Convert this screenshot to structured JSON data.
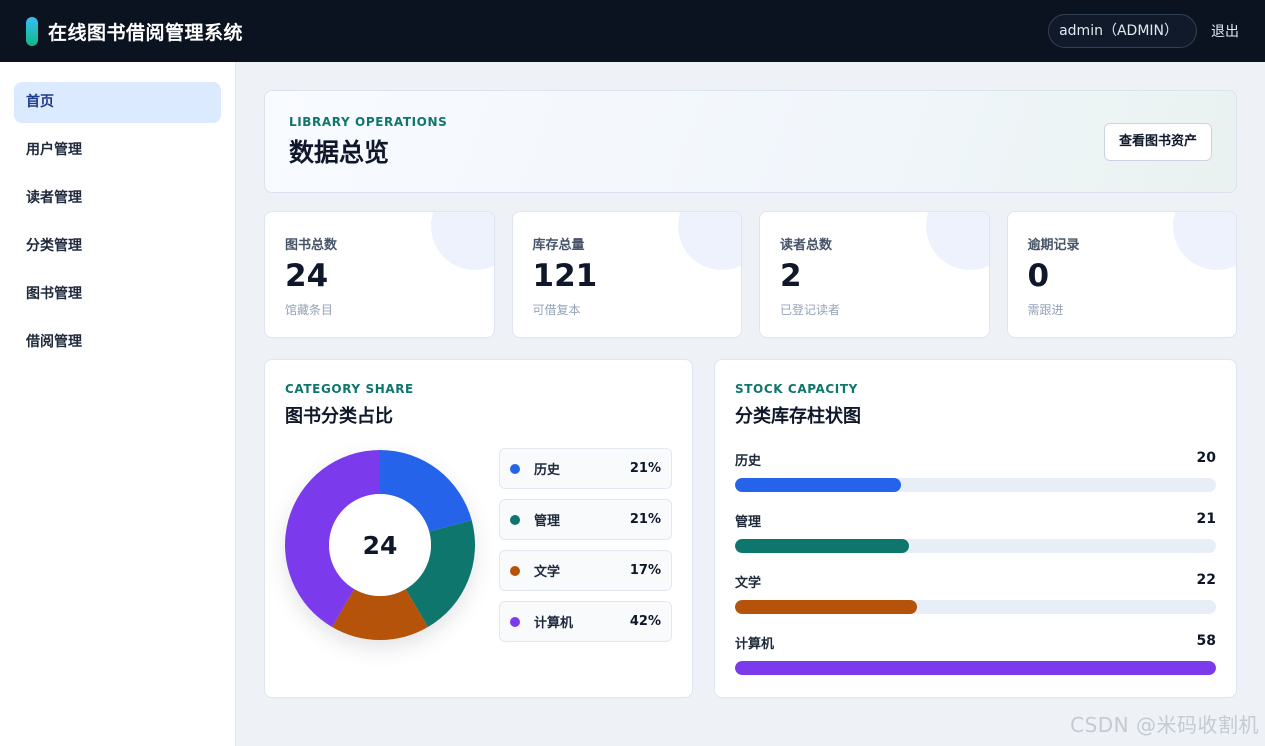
{
  "topbar": {
    "title": "在线图书借阅管理系统",
    "user": "admin（ADMIN）",
    "logout": "退出"
  },
  "sidebar": {
    "items": [
      {
        "label": "首页",
        "active": true
      },
      {
        "label": "用户管理"
      },
      {
        "label": "读者管理"
      },
      {
        "label": "分类管理"
      },
      {
        "label": "图书管理"
      },
      {
        "label": "借阅管理"
      }
    ]
  },
  "hero": {
    "eyebrow": "LIBRARY OPERATIONS",
    "title": "数据总览",
    "button": "查看图书资产"
  },
  "stats": [
    {
      "label": "图书总数",
      "value": "24",
      "sub": "馆藏条目"
    },
    {
      "label": "库存总量",
      "value": "121",
      "sub": "可借复本"
    },
    {
      "label": "读者总数",
      "value": "2",
      "sub": "已登记读者"
    },
    {
      "label": "逾期记录",
      "value": "0",
      "sub": "需跟进"
    }
  ],
  "category_panel": {
    "eyebrow": "CATEGORY SHARE",
    "title": "图书分类占比",
    "center_value": "24"
  },
  "stock_panel": {
    "eyebrow": "STOCK CAPACITY",
    "title": "分类库存柱状图"
  },
  "chart_data": [
    {
      "type": "pie",
      "categories": [
        "历史",
        "管理",
        "文学",
        "计算机"
      ],
      "values": [
        21,
        21,
        17,
        42
      ],
      "labels": [
        "21%",
        "21%",
        "17%",
        "42%"
      ],
      "colors": [
        "#2563eb",
        "#0f766e",
        "#b45309",
        "#7c3aed"
      ]
    },
    {
      "type": "bar",
      "categories": [
        "历史",
        "管理",
        "文学",
        "计算机"
      ],
      "values": [
        20,
        21,
        22,
        58
      ],
      "colors": [
        "#2563eb",
        "#0f766e",
        "#b45309",
        "#7c3aed"
      ],
      "xlim": [
        0,
        58
      ]
    }
  ],
  "watermark": "CSDN @米码收割机"
}
